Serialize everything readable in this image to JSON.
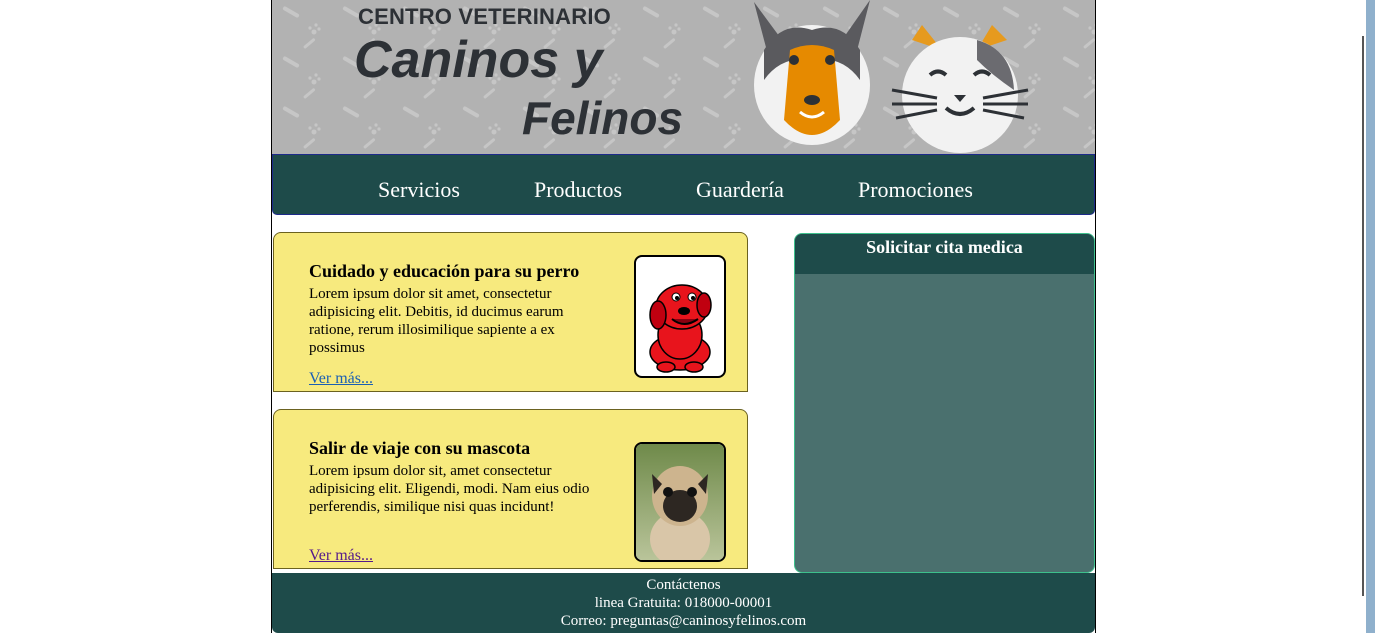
{
  "header": {
    "subtitle": "CENTRO VETERINARIO",
    "title_line1": "Caninos y",
    "title_line2": "Felinos"
  },
  "nav": {
    "items": [
      "Servicios",
      "Productos",
      "Guardería",
      "Promociones"
    ]
  },
  "articles": [
    {
      "title": "Cuidado y educación para su perro",
      "body": "Lorem ipsum dolor sit amet, consectetur adipisicing elit. Debitis, id ducimus earum ratione, rerum illosimilique sapiente a ex possimus",
      "link": "Ver más..."
    },
    {
      "title": "Salir de viaje con su mascota",
      "body": "Lorem ipsum dolor sit, amet consectetur adipisicing elit. Eligendi, modi. Nam eius odio perferendis, similique nisi quas incidunt!",
      "link": "Ver más..."
    }
  ],
  "sidebar": {
    "title": "Solicitar cita medica"
  },
  "footer": {
    "contact": "Contáctenos",
    "phone": "linea Gratuita: 018000-00001",
    "email": "Correo: preguntas@caninosyfelinos.com"
  },
  "colors": {
    "nav_bg": "#1e4b4a",
    "card_bg": "#f7ea7e",
    "sidebar_bg": "#4a706e",
    "link_visited": "#551a8b",
    "link": "#1a5fb4"
  }
}
